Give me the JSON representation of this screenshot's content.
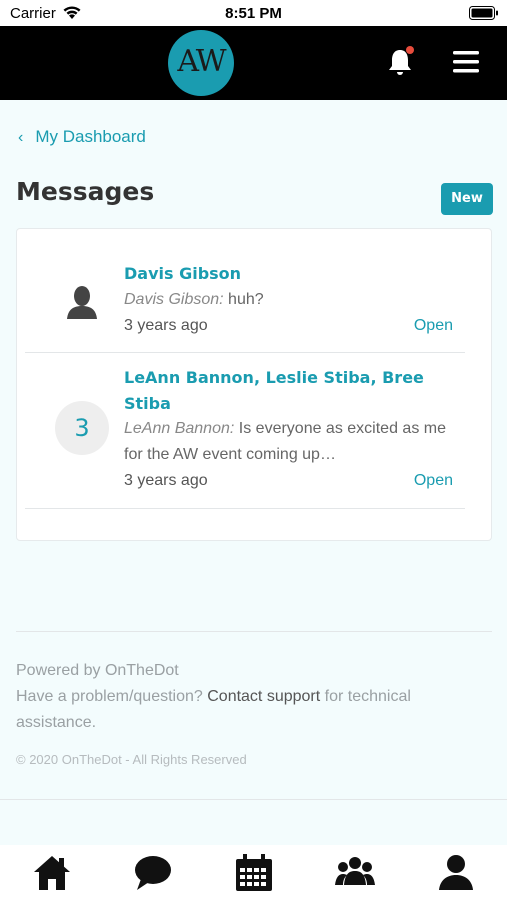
{
  "status_bar": {
    "carrier": "Carrier",
    "time": "8:51 PM"
  },
  "header": {
    "logo_text": "AW",
    "notification_dot_color": "#e74c3c"
  },
  "breadcrumb": {
    "chevron": "‹",
    "label": "My Dashboard"
  },
  "page": {
    "title": "Messages",
    "new_button_label": "New"
  },
  "messages": [
    {
      "avatar": "person-icon",
      "title": "Davis Gibson",
      "sender": "Davis Gibson:",
      "preview": " huh?",
      "time": "3 years ago",
      "open_label": "Open"
    },
    {
      "avatar_count": "3",
      "title": "LeAnn Bannon, Leslie Stiba, Bree Stiba",
      "sender": "LeAnn Bannon:",
      "preview": " Is everyone as excited as me for the AW event coming up…",
      "time": "3 years ago",
      "open_label": "Open"
    }
  ],
  "footer": {
    "powered_by": "Powered by OnTheDot",
    "help_prefix": "Have a problem/question? ",
    "help_link": "Contact support",
    "help_suffix": " for technical assistance.",
    "copyright": "© 2020 OnTheDot - All Rights Reserved"
  },
  "tab_bar": {
    "items": [
      "home-icon",
      "chat-icon",
      "calendar-icon",
      "group-icon",
      "profile-icon"
    ]
  },
  "colors": {
    "accent": "#1a9cb0",
    "header_bg": "#000000",
    "page_bg": "#f3fcfd"
  }
}
